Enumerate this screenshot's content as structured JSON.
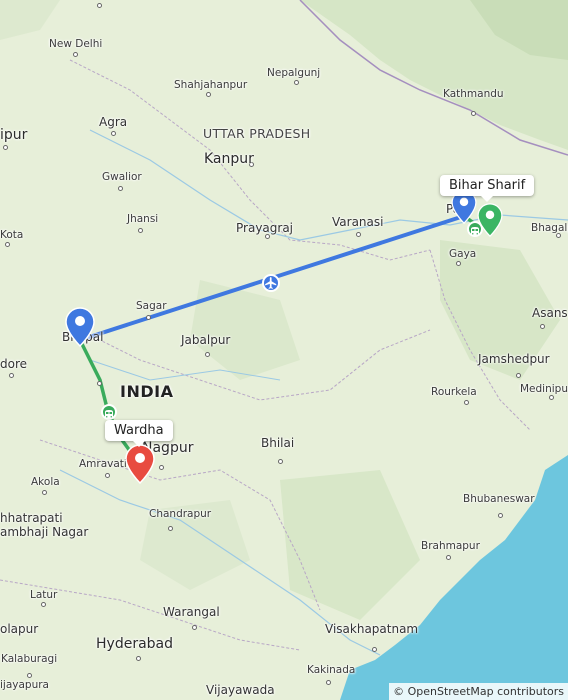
{
  "map": {
    "country_label": "INDIA",
    "state_label": "UTTAR PRADESH",
    "cities": {
      "new_delhi": "New Delhi",
      "shahjahanpur": "Shahjahanpur",
      "nepalgunj": "Nepalgunj",
      "kathmandu": "Kathmandu",
      "jaipur": "ipur",
      "agra": "Agra",
      "kanpur": "Kanpur",
      "gwalior": "Gwalior",
      "jhansi": "Jhansi",
      "kota": "Kota",
      "prayagraj": "Prayagraj",
      "varanasi": "Varanasi",
      "gaya": "Gaya",
      "bhagalpur": "Bhagalp",
      "patna": "Pa",
      "sagar": "Sagar",
      "asansol": "Asans",
      "bhopal": "Bhopal",
      "jabalpur": "Jabalpur",
      "indore": "dore",
      "jamshedpur": "Jamshedpur",
      "rourkela": "Rourkela",
      "medinipur": "Medinipur",
      "nagpur": "Nagpur",
      "amravati": "Amravati",
      "bhilai": "Bhilai",
      "akola": "Akola",
      "bhubaneswar": "Bhubaneswar",
      "chhatrapati_1": "hhatrapati",
      "chhatrapati_2": "ambhaji Nagar",
      "chandrapur": "Chandrapur",
      "brahmapur": "Brahmapur",
      "latur": "Latur",
      "solapur": "olapur",
      "warangal": "Warangal",
      "visakhapatnam": "Visakhapatnam",
      "hyderabad": "Hyderabad",
      "kalaburagi": "Kalaburagi",
      "kakinada": "Kakinada",
      "vijayawada": "Vijayawada",
      "vijayapura": "ijayapura"
    }
  },
  "route": {
    "origin": "Bhopal",
    "destination_label": "Wardha",
    "stop_label": "Bihar Sharif",
    "colors": {
      "flight": "#3f78e0",
      "rail": "#3aab5c",
      "origin_pin": "#3f78e0",
      "stop_pin": "#3f78e0",
      "destination_pin": "#e84b40",
      "station_pin": "#3bb564",
      "sea": "#6dc6de"
    },
    "icons": [
      "airplane-icon",
      "train-icon",
      "map-pin-icon"
    ]
  },
  "attribution": "© OpenStreetMap contributors"
}
